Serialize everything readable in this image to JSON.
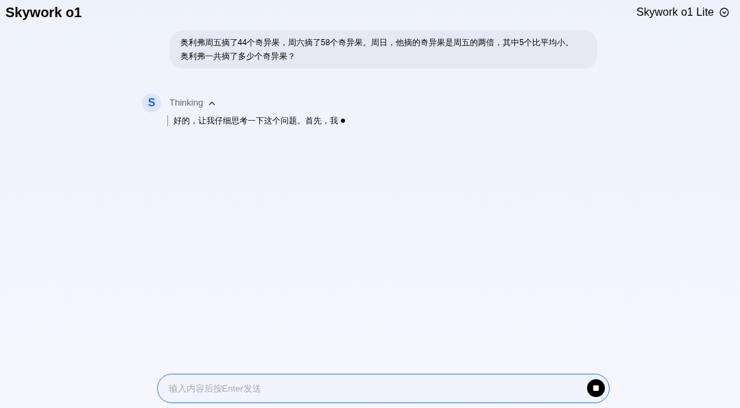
{
  "header": {
    "title": "Skywork o1",
    "model": "Skywork o1 Lite"
  },
  "messages": [
    {
      "kind": "user",
      "text": "奥利弗周五摘了44个奇异果，周六摘了58个奇异果。周日，他摘的奇异果是周五的两倍，其中5个比平均小。奥利弗一共摘了多少个奇异果？"
    },
    {
      "kind": "assistant",
      "avatar": "S",
      "thinking_label": "Thinking",
      "expanded": true,
      "text": "好的，让我仔细思考一下这个问题。首先，我"
    }
  ],
  "composer": {
    "placeholder": "输入内容后按Enter发送"
  }
}
